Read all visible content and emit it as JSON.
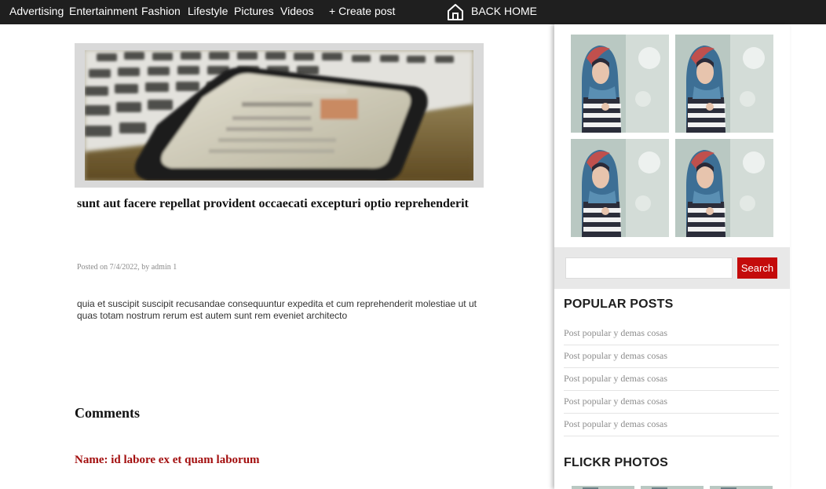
{
  "nav": {
    "links": [
      "Advertising",
      "Entertainment",
      "Fashion",
      "Lifestyle",
      "Pictures",
      "Videos"
    ],
    "create_post": "+ Create post",
    "back_home": "BACK HOME",
    "back_home_icon": "home-icon",
    "bar_color": "#1f1f1f"
  },
  "post": {
    "title": "sunt aut facere repellat provident occaecati excepturi optio reprehenderit",
    "meta": "Posted on 7/4/2022, by admin 1",
    "body": "quia et suscipit suscipit recusandae consequuntur expedita et cum reprehenderit molestiae ut ut quas totam nostrum rerum est autem sunt rem eveniet architecto"
  },
  "comments": {
    "heading": "Comments",
    "items": [
      {
        "name_label": "Name: ",
        "name": "id labore ex et quam laborum"
      }
    ]
  },
  "sidebar": {
    "search": {
      "placeholder": "",
      "button_label": "Search",
      "button_color": "#c40b0b"
    },
    "popular": {
      "title": "POPULAR POSTS",
      "items": [
        "Post popular y demas cosas",
        "Post popular y demas cosas",
        "Post popular y demas cosas",
        "Post popular y demas cosas",
        "Post popular y demas cosas"
      ]
    },
    "flickr": {
      "title": "FLICKR PHOTOS"
    }
  },
  "colors": {
    "accent_red": "#c40b0b",
    "comment_name_red": "#a30f0f"
  }
}
